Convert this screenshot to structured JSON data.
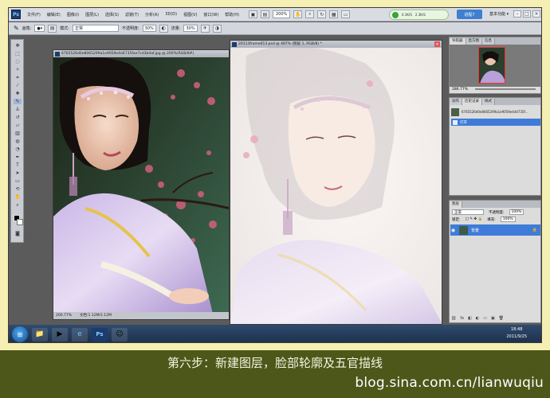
{
  "app": {
    "logo": "Ps"
  },
  "menu": [
    "文件(F)",
    "编辑(E)",
    "图像(I)",
    "图层(L)",
    "选择(S)",
    "滤镜(T)",
    "分析(A)",
    "3D(D)",
    "视图(V)",
    "窗口(W)",
    "帮助(H)"
  ],
  "toolbar": {
    "zoom": "200%",
    "workspace": "基本功能 ▾"
  },
  "speed_widget": {
    "up": "0.3K/S",
    "down": "2.3K/S",
    "button": "进程7"
  },
  "options": {
    "brush_label": "画笔:",
    "mode_label": "模式:",
    "mode_value": "正常",
    "opacity_label": "不透明度:",
    "opacity_value": "30%",
    "flow_label": "流量:",
    "flow_value": "30%"
  },
  "doc_left": {
    "title": "6765526d0e8065299a1e9059e4d4735fae7cd3b4af.jpg @ 200%(RGB/8#)",
    "zoom": "200.77%",
    "doc_info": "文档:1.12M/1.12M"
  },
  "doc_right": {
    "title": "20113frame013.psd @ 487% (图层 1, RGB/8) *"
  },
  "nav_panel": {
    "tabs": [
      "导航器",
      "直方图",
      "信息"
    ],
    "zoom": "286.77%"
  },
  "history_panel": {
    "tabs": [
      "动作",
      "历史记录",
      "样式"
    ],
    "snapshot": "6765526d0e8065299a1e9059e4d4735f...",
    "open_step": "打开"
  },
  "layers_panel": {
    "tab": "图层",
    "blend": "正常",
    "opacity_label": "不透明度:",
    "opacity": "100%",
    "lock_label": "锁定:",
    "fill_label": "填充:",
    "fill": "100%",
    "layer_name": "背景"
  },
  "taskbar": {
    "time": "18:48",
    "date": "2011/9/25"
  },
  "caption": "第六步：新建图层，脸部轮廓及五官描线",
  "watermark": "blog.sina.com.cn/lianwuqiu"
}
